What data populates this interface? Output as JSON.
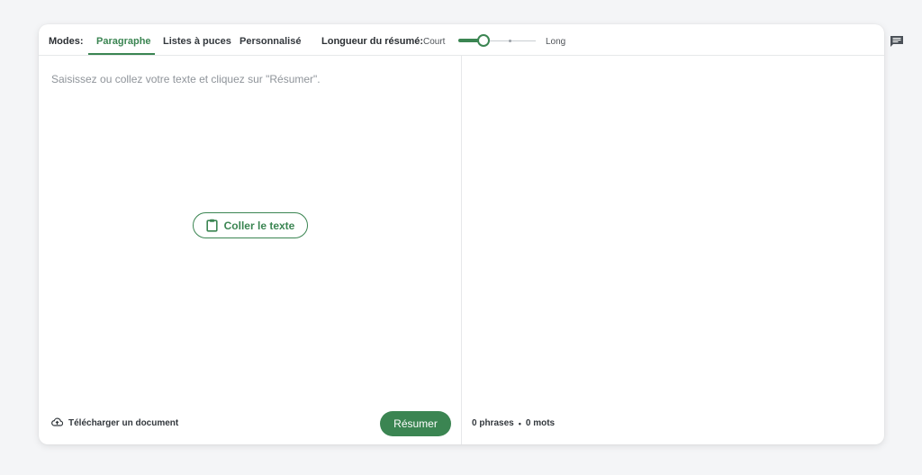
{
  "toolbar": {
    "modes_label": "Modes:",
    "tabs": [
      {
        "label": "Paragraphe",
        "active": true
      },
      {
        "label": "Listes à puces",
        "active": false
      },
      {
        "label": "Personnalisé",
        "active": false
      }
    ],
    "length_label": "Longueur du résumé:",
    "length_short": "Court",
    "length_long": "Long",
    "length_value": 0.33
  },
  "input": {
    "placeholder": "Saisissez ou collez votre texte et cliquez sur \"Résumer\".",
    "paste_button": "Coller le texte",
    "upload_label": "Télécharger un document",
    "summarize_button": "Résumer"
  },
  "output": {
    "sentences": "0 phrases",
    "separator": "•",
    "words": "0 mots"
  },
  "icons": {
    "paste": "clipboard-icon",
    "upload": "cloud-upload-icon",
    "feedback": "chat-feedback-icon"
  },
  "colors": {
    "accent": "#3b8552",
    "background": "#f4f5f7"
  }
}
